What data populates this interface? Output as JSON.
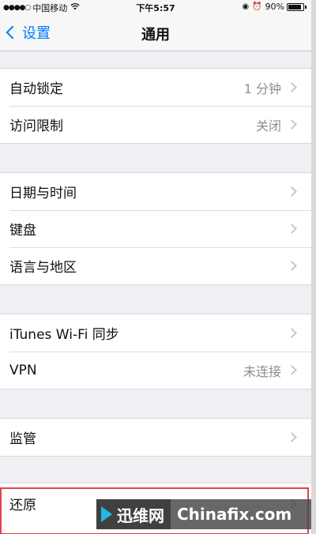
{
  "status_bar": {
    "signal": "●●●●○",
    "carrier": "中国移动",
    "wifi_icon": "wifi-icon",
    "time": "下午5:57",
    "battery_percent": "90%",
    "battery_level": 0.9
  },
  "nav": {
    "back_label": "设置",
    "title": "通用"
  },
  "groups": [
    {
      "rows": [
        {
          "label": "自动锁定",
          "value": "1 分钟"
        },
        {
          "label": "访问限制",
          "value": "关闭"
        }
      ]
    },
    {
      "rows": [
        {
          "label": "日期与时间",
          "value": ""
        },
        {
          "label": "键盘",
          "value": ""
        },
        {
          "label": "语言与地区",
          "value": ""
        }
      ]
    },
    {
      "rows": [
        {
          "label": "iTunes Wi-Fi 同步",
          "value": ""
        },
        {
          "label": "VPN",
          "value": "未连接"
        }
      ]
    },
    {
      "rows": [
        {
          "label": "监管",
          "value": ""
        }
      ]
    },
    {
      "rows": [
        {
          "label": "还原",
          "value": ""
        }
      ]
    }
  ],
  "watermark": {
    "cn": "迅维网",
    "en": "Chinafix.com"
  },
  "colors": {
    "accent": "#007aff",
    "highlight": "#e0454a",
    "background": "#efeff4"
  }
}
